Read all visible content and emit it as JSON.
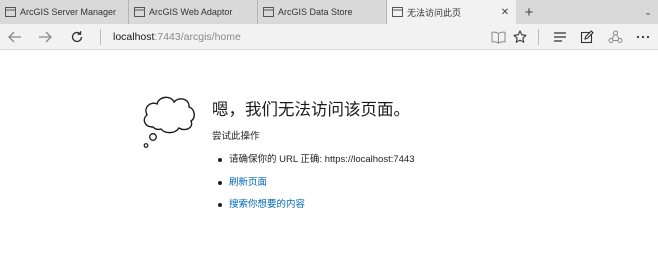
{
  "tabs": [
    {
      "title": "ArcGIS Server Manager",
      "active": false
    },
    {
      "title": "ArcGIS Web Adaptor",
      "active": false
    },
    {
      "title": "ArcGIS Data Store",
      "active": false
    },
    {
      "title": "无法访问此页",
      "active": true
    }
  ],
  "address_bar": {
    "host": "localhost",
    "path": ":7443/arcgis/home"
  },
  "error_page": {
    "heading": "嗯，我们无法访问该页面。",
    "subheading": "尝试此操作",
    "suggestion_check_url": "请确保你的 URL 正确: https://localhost:7443",
    "suggestion_refresh": "刷新页面",
    "suggestion_search": "搜索你想要的内容"
  },
  "icons": {
    "tab": "page-icon",
    "back": "back-arrow-icon",
    "forward": "forward-arrow-icon",
    "refresh": "refresh-icon",
    "reading_view": "book-icon",
    "favorites": "star-icon",
    "hub": "hub-icon",
    "notes": "pen-icon",
    "share": "share-icon",
    "more": "more-icon",
    "error": "cloud-icon"
  },
  "colors": {
    "link": "#0067b8",
    "tab_strip": "#d9d9d9",
    "active_tab": "#f2f2f2"
  }
}
